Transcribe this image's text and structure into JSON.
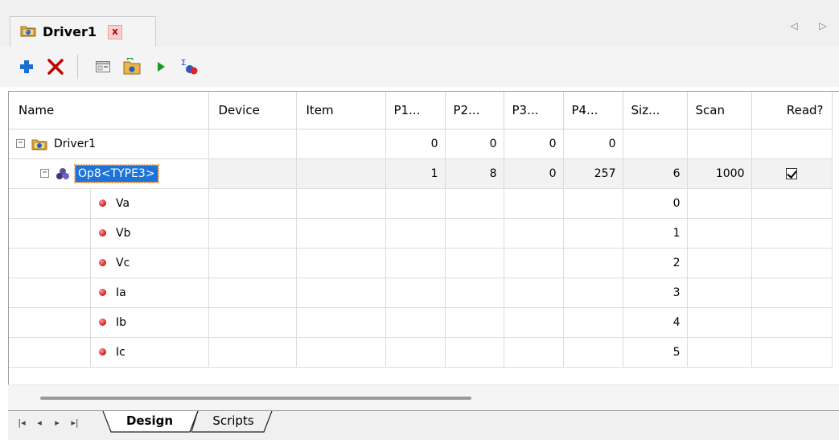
{
  "window": {
    "tab_title": "Driver1",
    "close_glyph": "x",
    "nav_left": "◁",
    "nav_right": "▷"
  },
  "toolbar": {
    "buttons": [
      {
        "name": "add",
        "icon": "plus-icon",
        "color": "#1a6fd1"
      },
      {
        "name": "delete",
        "icon": "x-icon",
        "color": "#c00000"
      },
      {
        "name": "properties",
        "icon": "window-icon"
      },
      {
        "name": "open-folder",
        "icon": "folder-icon"
      },
      {
        "name": "run",
        "icon": "play-icon",
        "color": "#1a9a1a"
      },
      {
        "name": "summary",
        "icon": "sigma-icon"
      }
    ]
  },
  "grid": {
    "columns": [
      "Name",
      "Device",
      "Item",
      "P1...",
      "P2...",
      "P3...",
      "P4...",
      "Siz...",
      "Scan",
      "Read?"
    ],
    "rows": [
      {
        "name": "Driver1",
        "level": 0,
        "expander": "−",
        "icon": "driver-icon",
        "device": "",
        "item": "",
        "p1": "0",
        "p2": "0",
        "p3": "0",
        "p4": "0",
        "size": "",
        "scan": "",
        "read": ""
      },
      {
        "name": "Op8<TYPE3>",
        "level": 1,
        "expander": "−",
        "icon": "operation-icon",
        "selected": true,
        "device": "",
        "item": "",
        "p1": "1",
        "p2": "8",
        "p3": "0",
        "p4": "257",
        "size": "6",
        "scan": "1000",
        "read": true
      },
      {
        "name": "Va",
        "level": 2,
        "icon": "tag-dot-icon",
        "size": "0"
      },
      {
        "name": "Vb",
        "level": 2,
        "icon": "tag-dot-icon",
        "size": "1"
      },
      {
        "name": "Vc",
        "level": 2,
        "icon": "tag-dot-icon",
        "size": "2"
      },
      {
        "name": "Ia",
        "level": 2,
        "icon": "tag-dot-icon",
        "size": "3"
      },
      {
        "name": "Ib",
        "level": 2,
        "icon": "tag-dot-icon",
        "size": "4"
      },
      {
        "name": "Ic",
        "level": 2,
        "icon": "tag-dot-icon",
        "size": "5"
      }
    ]
  },
  "sheets": {
    "nav": [
      "|◂",
      "◂",
      "▸",
      "▸|"
    ],
    "tabs": [
      {
        "label": "Design",
        "active": true
      },
      {
        "label": "Scripts",
        "active": false
      }
    ]
  },
  "colors": {
    "selection": "#1e73d8",
    "selection_border": "#e08a3c",
    "tag_dot": "#d9262a"
  }
}
